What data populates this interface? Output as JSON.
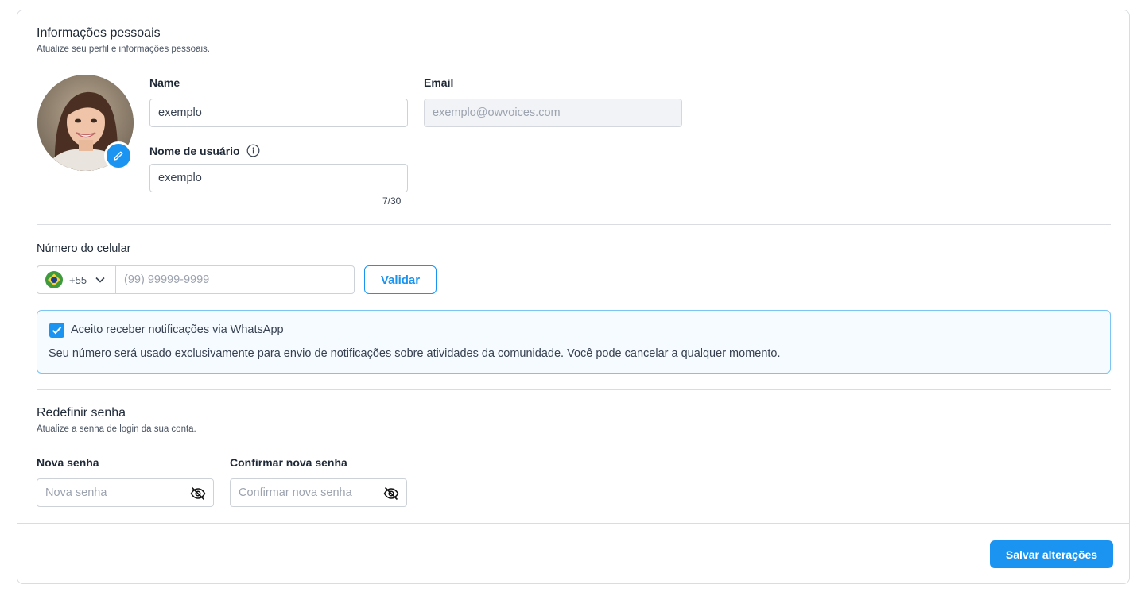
{
  "profile": {
    "title": "Informações pessoais",
    "subtitle": "Atualize seu perfil e informações pessoais.",
    "name_label": "Name",
    "name_value": "exemplo",
    "email_label": "Email",
    "email_placeholder": "exemplo@owvoices.com",
    "username_label": "Nome de usuário",
    "username_value": "exemplo",
    "username_counter": "7/30"
  },
  "phone": {
    "label": "Número do celular",
    "country_code": "+55",
    "country_flag": "brazil-flag",
    "placeholder": "(99) 99999-9999",
    "validate_label": "Validar"
  },
  "whatsapp": {
    "checked": true,
    "label": "Aceito receber notificações via WhatsApp",
    "description": "Seu número será usado exclusivamente para envio de notificações sobre atividades da comunidade. Você pode cancelar a qualquer momento."
  },
  "password": {
    "title": "Redefinir senha",
    "subtitle": "Atualize a senha de login da sua conta.",
    "new_label": "Nova senha",
    "new_placeholder": "Nova senha",
    "confirm_label": "Confirmar nova senha",
    "confirm_placeholder": "Confirmar nova senha"
  },
  "footer": {
    "save_label": "Salvar alterações"
  },
  "colors": {
    "accent": "#1a94f0",
    "border": "#d9dde3",
    "notify_bg": "#f5fbff"
  }
}
